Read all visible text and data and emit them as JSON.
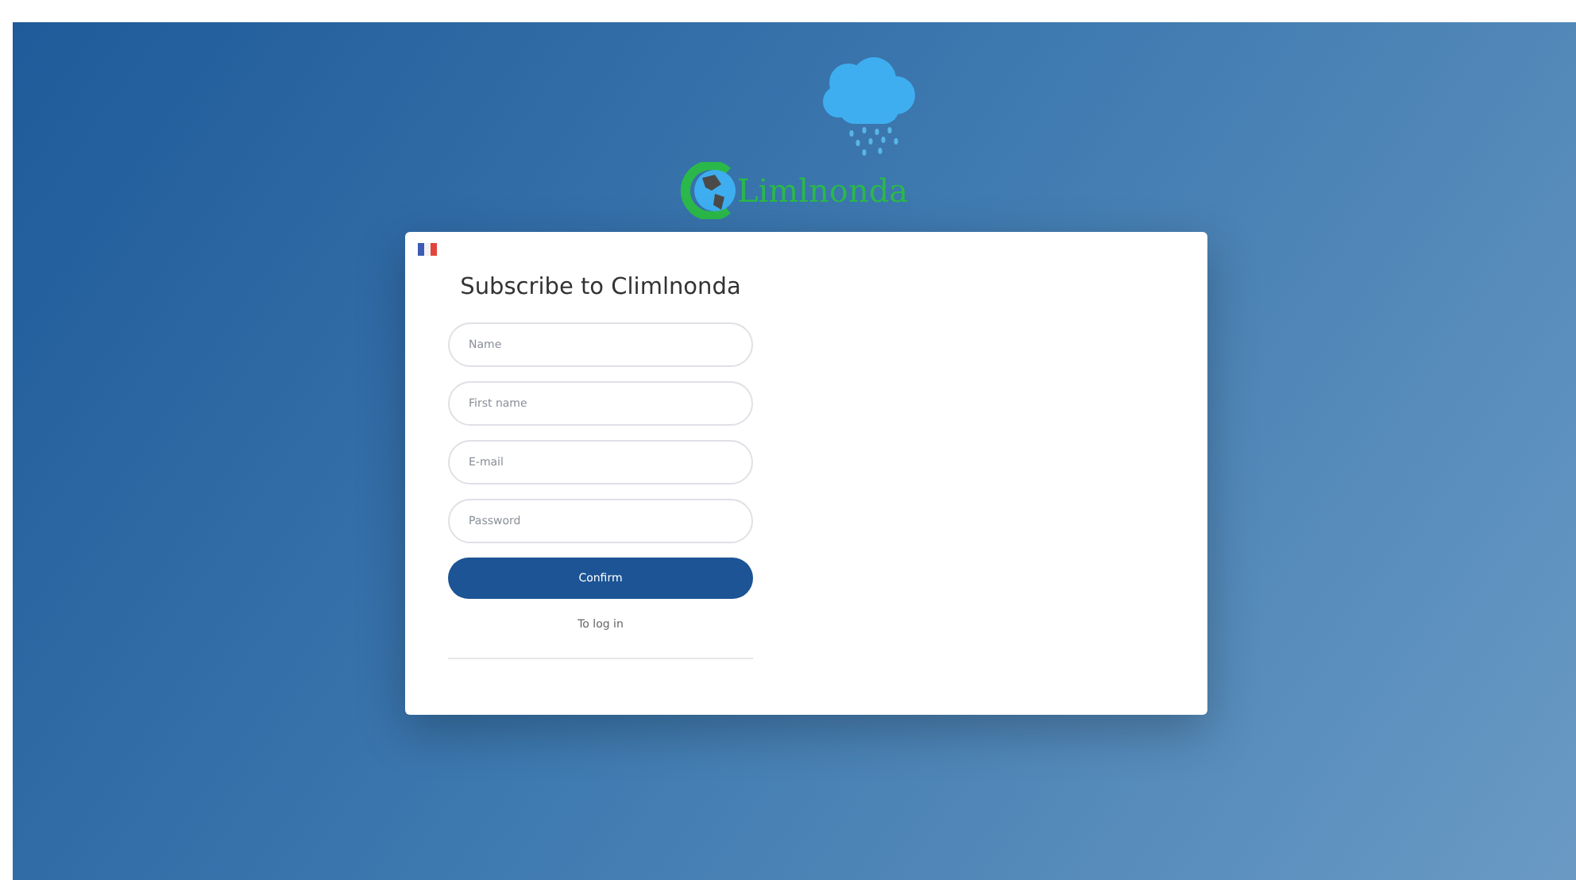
{
  "logo": {
    "text": "Limlnonda"
  },
  "form": {
    "title": "Subscribe to Climlnonda",
    "fields": [
      {
        "placeholder": "Name"
      },
      {
        "placeholder": "First name"
      },
      {
        "placeholder": "E-mail"
      },
      {
        "placeholder": "Password"
      }
    ],
    "submit": "Confirm",
    "login_link": "To log in"
  }
}
